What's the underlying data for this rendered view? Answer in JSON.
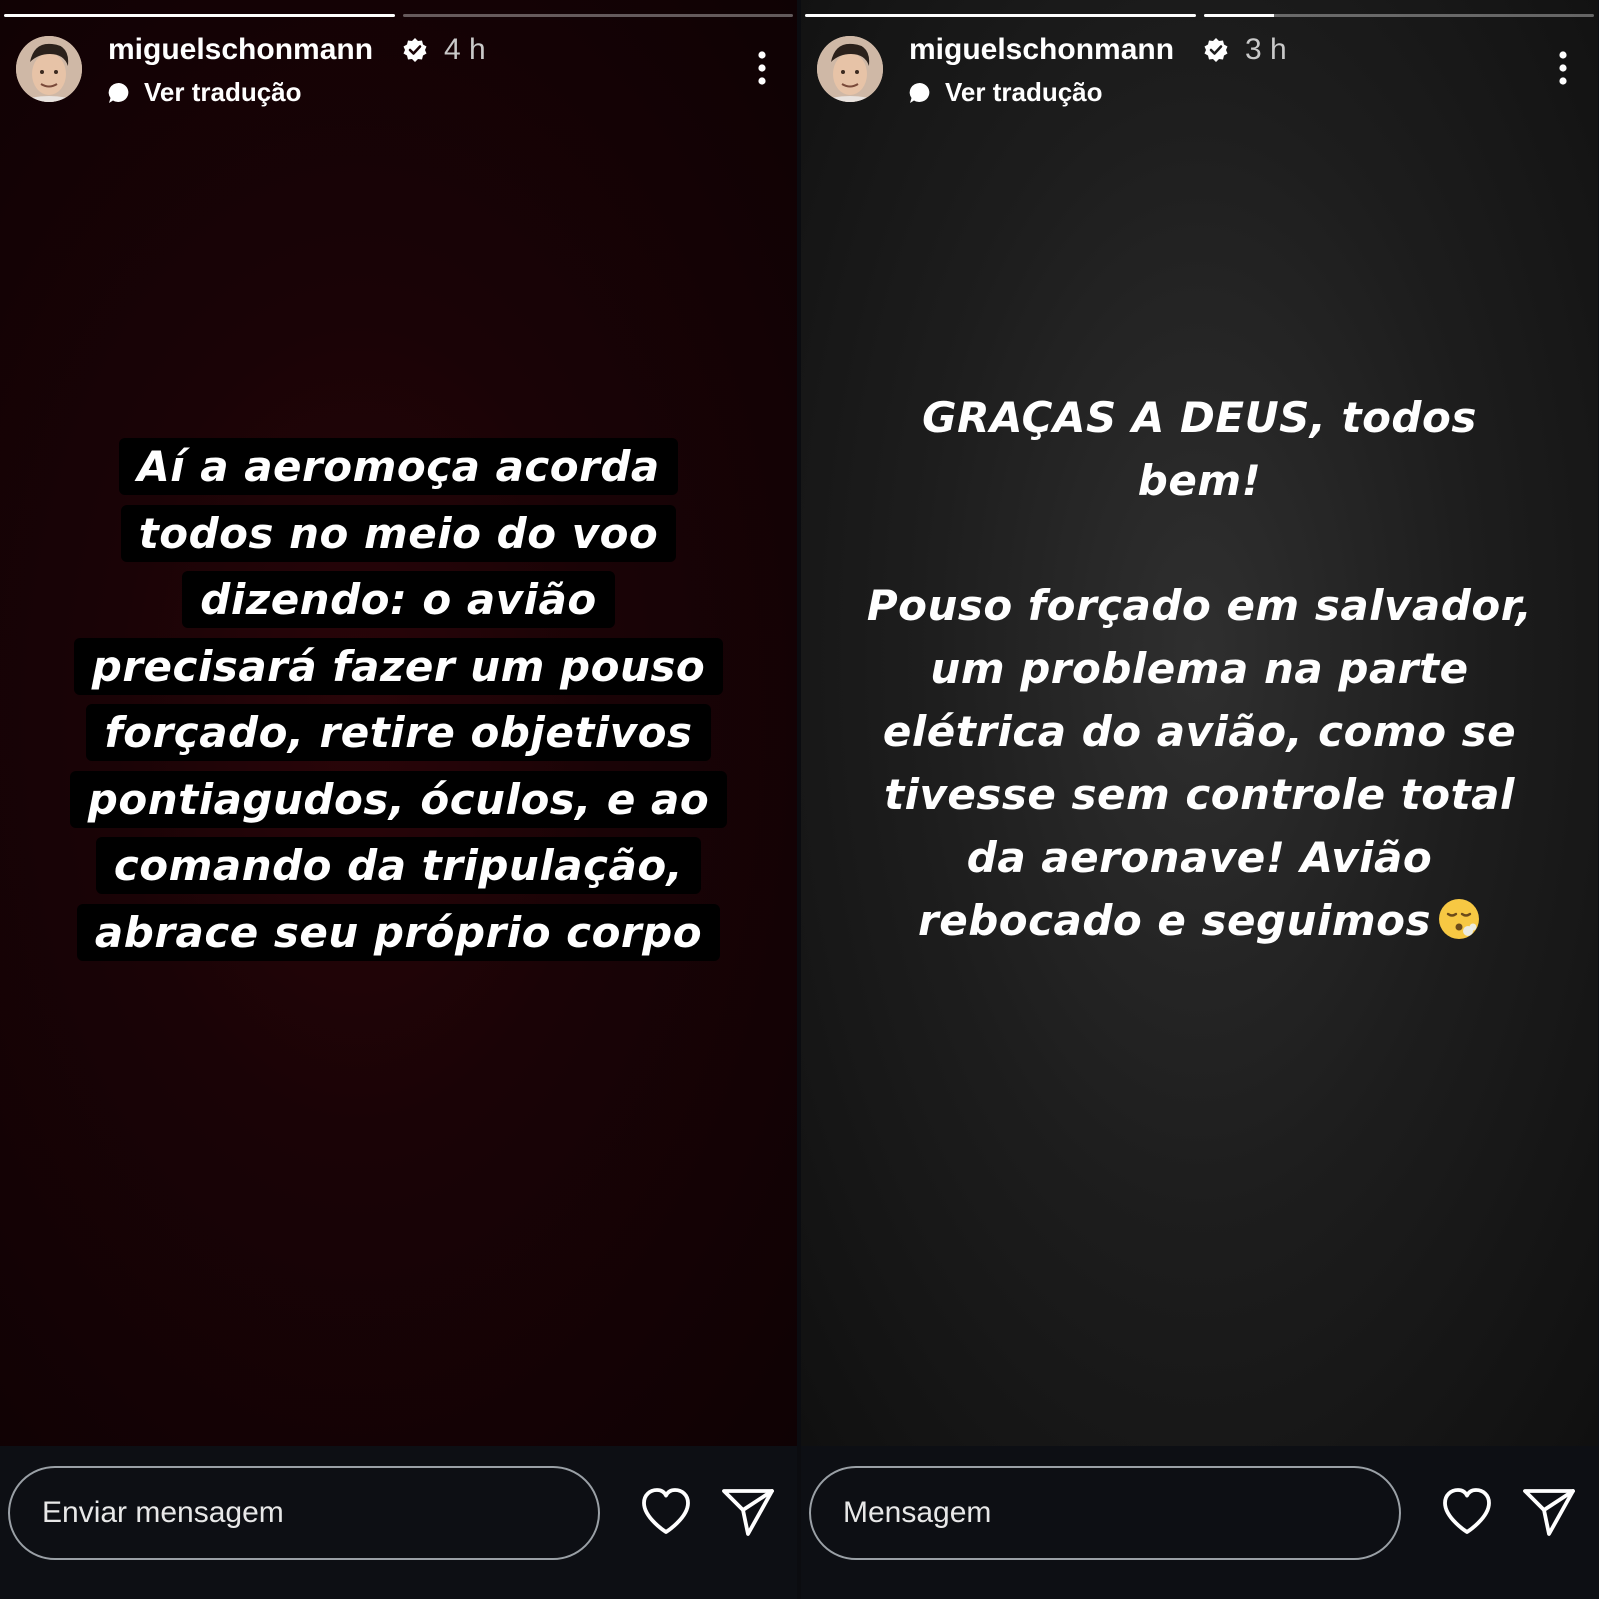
{
  "left_story": {
    "username": "miguelschonmann",
    "time": "4 h",
    "translate_label": "Ver tradução",
    "progress": [
      1.0,
      0.0
    ],
    "story_text_lines": [
      "Aí a aeromoça acorda",
      "todos no meio do voo",
      "dizendo: o avião",
      "precisará fazer um pouso",
      "forçado, retire objetivos",
      "pontiagudos, óculos, e ao",
      "comando da tripulação,",
      "abrace seu próprio corpo"
    ],
    "message_placeholder": "Enviar mensagem"
  },
  "right_story": {
    "username": "miguelschonmann",
    "time": "3 h",
    "translate_label": "Ver tradução",
    "progress": [
      1.0,
      0.18
    ],
    "story_title_lines": [
      "GRAÇAS A DEUS, todos",
      "bem!"
    ],
    "story_body_lines": [
      "Pouso forçado em salvador,",
      "um problema na parte",
      "elétrica do avião, como se",
      "tivesse sem controle total",
      "da aeronave! Avião",
      "rebocado e seguimos"
    ],
    "emoji": "face-exhaling-emoji",
    "message_placeholder": "Mensagem"
  },
  "colors": {
    "left_background": "#1a0306",
    "right_background": "#1d1d1d",
    "bottom_bar": "#0d0f14",
    "text": "#ffffff",
    "input_border": "#9aa0a6"
  },
  "icons": {
    "verified": "verified-badge-icon",
    "translate": "speech-bubble-icon",
    "more": "more-vertical-icon",
    "like": "heart-icon",
    "share": "send-icon"
  }
}
